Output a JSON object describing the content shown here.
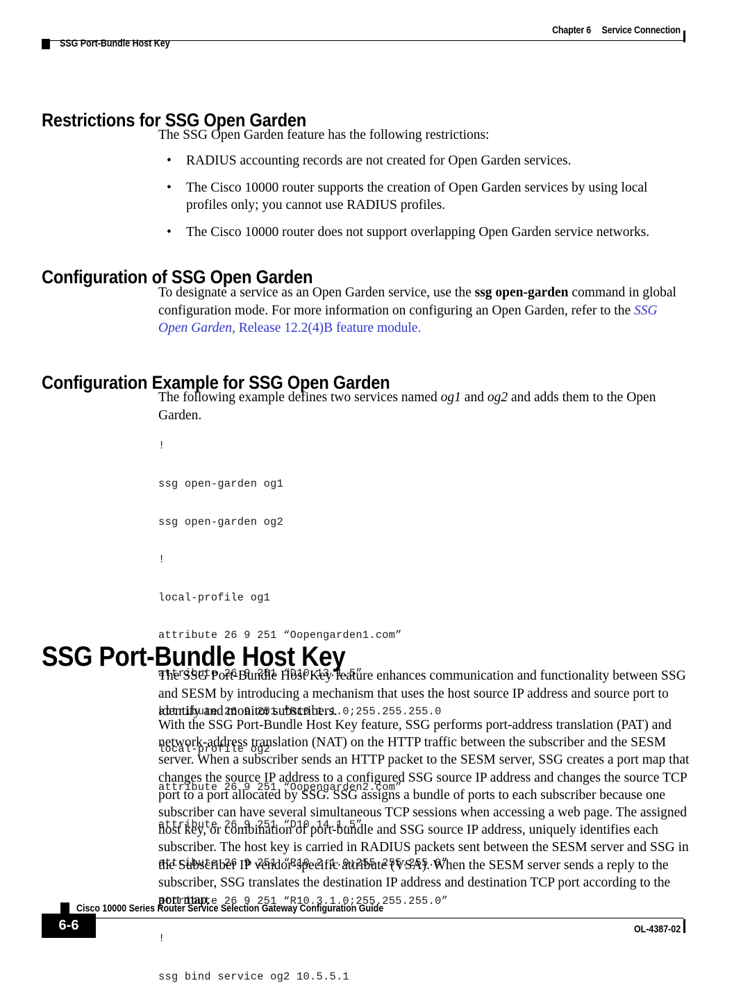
{
  "header": {
    "chapter_label": "Chapter 6",
    "chapter_title": "Service Connection",
    "running_head": "SSG Port-Bundle Host Key"
  },
  "sections": {
    "restrictions": {
      "heading": "Restrictions for SSG Open Garden",
      "intro": "The SSG Open Garden feature has the following restrictions:",
      "bullet_marker": "•",
      "bullets": [
        "RADIUS accounting records are not created for Open Garden services.",
        "The Cisco 10000 router supports the creation of Open Garden services by using local profiles only; you cannot use RADIUS profiles.",
        "The Cisco 10000 router does not support overlapping Open Garden service networks."
      ]
    },
    "configuration": {
      "heading": "Configuration of SSG Open Garden",
      "para_part1": "To designate a service as an Open Garden service, use the ",
      "para_command": "ssg open-garden",
      "para_part2": " command in global configuration mode. For more information on configuring an Open Garden, refer to the ",
      "link_italic": "SSG Open Garden",
      "link_rest": ", Release 12.2(4)B feature module.",
      "link_color": "#3333CC"
    },
    "config_example": {
      "heading": "Configuration Example for SSG Open Garden",
      "intro_part1": "The following example defines two services named ",
      "intro_em1": "og1",
      "intro_part2": " and ",
      "intro_em2": "og2",
      "intro_part3": " and adds them to the Open Garden.",
      "code_lines": [
        "!",
        "ssg open-garden og1",
        "ssg open-garden og2",
        "!",
        "local-profile og1",
        "attribute 26 9 251 “Oopengarden1.com”",
        "attribute 26 9 251 “D10.13.1.5”",
        "attribute 26 9 251 “R10.1.1.0;255.255.255.0",
        "local-profile og2",
        "attribute 26 9 251 “Oopengarden2.com”",
        "attribute 26 9 251 “D10.14.1.5”",
        "attribute 26 9 251 “R10.2.1.0;255.255.255.0”",
        "attribute 26 9 251 “R10.3.1.0;255.255.255.0”",
        "!",
        "ssg bind service og2 10.5.5.1"
      ]
    },
    "host_key": {
      "heading": "SSG Port-Bundle Host Key",
      "para1": "The SSG Port-Bundle Host Key feature enhances communication and functionality between SSG and SESM by introducing a mechanism that uses the host source IP address and source port to identify and monitor subscribers.",
      "para2": "With the SSG Port-Bundle Host Key feature, SSG performs port-address translation (PAT) and network-address translation (NAT) on the HTTP traffic between the subscriber and the SESM server. When a subscriber sends an HTTP packet to the SESM server, SSG creates a port map that changes the source IP address to a configured SSG source IP address and changes the source TCP port to a port allocated by SSG. SSG assigns a bundle of ports to each subscriber because one subscriber can have several simultaneous TCP sessions when accessing a web page. The assigned host key, or combination of port-bundle and SSG source IP address, uniquely identifies each subscriber. The host key is carried in RADIUS packets sent between the SESM server and SSG in the Subscriber IP vendor-specific attribute (VSA). When the SESM server sends a reply to the subscriber, SSG translates the destination IP address and destination TCP port according to the port map."
    }
  },
  "footer": {
    "page_number": "6-6",
    "guide_title": "Cisco 10000 Series Router Service Selection Gateway Configuration Guide",
    "doc_number": "OL-4387-02"
  }
}
